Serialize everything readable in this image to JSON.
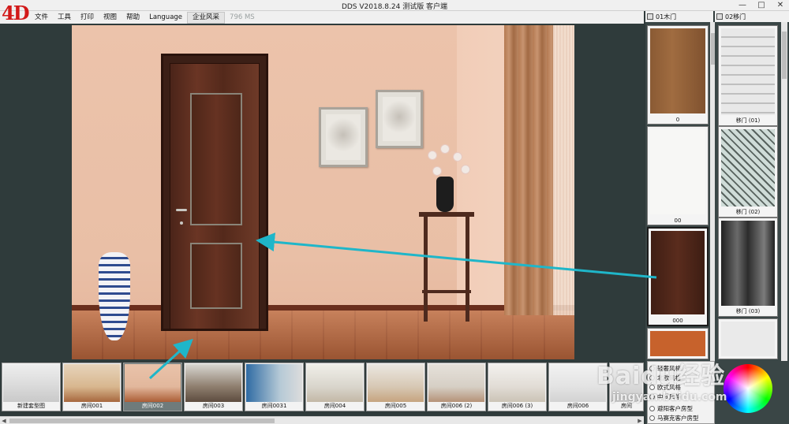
{
  "window": {
    "title": "DDS V2018.8.24 测试版 客户端",
    "logo_text": "4D",
    "minimize_glyph": "—",
    "maximize_glyph": "□",
    "close_glyph": "✕"
  },
  "menubar": {
    "items": [
      "文件",
      "工具",
      "打印",
      "视图",
      "帮助",
      "Language",
      "企业风采"
    ],
    "latency": "796 MS"
  },
  "right_panels": [
    {
      "title": "01木门",
      "tiles": [
        {
          "label": "0"
        },
        {
          "label": "00"
        },
        {
          "label": "000"
        },
        {
          "label": ""
        }
      ]
    },
    {
      "title": "02移门",
      "tiles": [
        {
          "label": "移门 (01)"
        },
        {
          "label": "移门 (02)"
        },
        {
          "label": "移门 (03)"
        },
        {
          "label": ""
        }
      ]
    }
  ],
  "thumbnails": [
    {
      "label": "新建套型图"
    },
    {
      "label": "房间001"
    },
    {
      "label": "房间002"
    },
    {
      "label": "房间003"
    },
    {
      "label": "房间0031"
    },
    {
      "label": "房间004"
    },
    {
      "label": "房间005"
    },
    {
      "label": "房间006 (2)"
    },
    {
      "label": "房间006 (3)"
    },
    {
      "label": "房间006"
    },
    {
      "label": "房间"
    }
  ],
  "style_list": {
    "items": [
      "轻奢风格",
      "北欧风格",
      "欧式风格",
      "中式风格",
      "避阳客户房型",
      "马赛克客户房型"
    ]
  },
  "watermark": {
    "line1": "Baidu经验",
    "line2": "jingyan.baidu.com"
  },
  "colors": {
    "arrow": "#1fb6c9",
    "background": "#2f3a3a",
    "logo": "#d21a1a"
  },
  "icons": {
    "panel_header": "window-icon"
  }
}
